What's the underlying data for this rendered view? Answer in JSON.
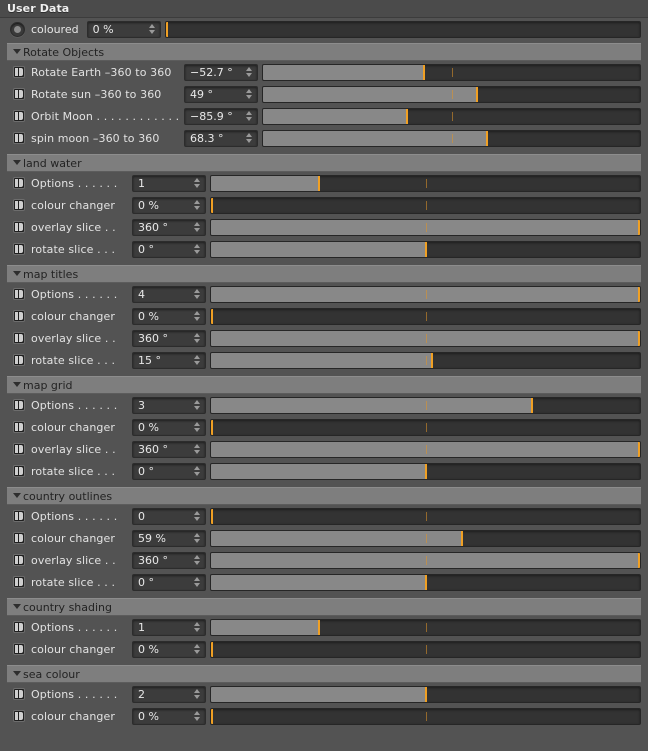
{
  "window": {
    "title": "User Data"
  },
  "top_row": {
    "icon": "radio-button-selected",
    "label": "coloured",
    "value": "0 %",
    "slider": {
      "fill_pct": 0,
      "knob_pct": 0,
      "mid_pct": null
    }
  },
  "sections": [
    {
      "name": "Rotate Objects",
      "label_width": "wide",
      "rows": [
        {
          "icon": "keyframe-track-icon",
          "label": "Rotate Earth –360 to 360",
          "value": "−52.7 °",
          "slider": {
            "fill_pct": 42.6,
            "knob_pct": 42.6,
            "mid_pct": 50
          }
        },
        {
          "icon": "keyframe-track-icon",
          "label": "Rotate sun –360 to 360",
          "value": "49 °",
          "slider": {
            "fill_pct": 56.8,
            "knob_pct": 56.8,
            "mid_pct": 50
          }
        },
        {
          "icon": "keyframe-track-icon",
          "label": "Orbit Moon . . . . . . . . . . . .",
          "value": "−85.9 °",
          "slider": {
            "fill_pct": 38.1,
            "knob_pct": 38.1,
            "mid_pct": 50
          }
        },
        {
          "icon": "keyframe-track-icon",
          "label": "spin moon –360 to 360",
          "value": "68.3 °",
          "slider": {
            "fill_pct": 59.5,
            "knob_pct": 59.5,
            "mid_pct": 50
          }
        }
      ]
    },
    {
      "name": "land water",
      "label_width": "narrow",
      "rows": [
        {
          "icon": "keyframe-track-icon",
          "label": "Options . . . . . .",
          "value": "1",
          "slider": {
            "fill_pct": 25.2,
            "knob_pct": 25.2,
            "mid_pct": 50
          }
        },
        {
          "icon": "keyframe-track-icon",
          "label": "colour changer",
          "value": "0 %",
          "slider": {
            "fill_pct": 0,
            "knob_pct": 0,
            "mid_pct": 50
          }
        },
        {
          "icon": "keyframe-track-icon",
          "label": "overlay slice . .",
          "value": "360 °",
          "slider": {
            "fill_pct": 100,
            "knob_pct": 100,
            "mid_pct": 50
          }
        },
        {
          "icon": "keyframe-track-icon",
          "label": "rotate slice . . .",
          "value": "0 °",
          "slider": {
            "fill_pct": 50,
            "knob_pct": 50,
            "mid_pct": 50
          }
        }
      ]
    },
    {
      "name": "map titles",
      "label_width": "narrow",
      "rows": [
        {
          "icon": "keyframe-track-icon",
          "label": "Options . . . . . .",
          "value": "4",
          "slider": {
            "fill_pct": 100,
            "knob_pct": 100,
            "mid_pct": 50
          }
        },
        {
          "icon": "keyframe-track-icon",
          "label": "colour changer",
          "value": "0 %",
          "slider": {
            "fill_pct": 0,
            "knob_pct": 0,
            "mid_pct": 50
          }
        },
        {
          "icon": "keyframe-track-icon",
          "label": "overlay slice . .",
          "value": "360 °",
          "slider": {
            "fill_pct": 100,
            "knob_pct": 100,
            "mid_pct": 50
          }
        },
        {
          "icon": "keyframe-track-icon",
          "label": "rotate slice . . .",
          "value": "15 °",
          "slider": {
            "fill_pct": 51.5,
            "knob_pct": 51.5,
            "mid_pct": 50
          }
        }
      ]
    },
    {
      "name": "map grid",
      "label_width": "narrow",
      "rows": [
        {
          "icon": "keyframe-track-icon",
          "label": "Options . . . . . .",
          "value": "3",
          "slider": {
            "fill_pct": 74.8,
            "knob_pct": 74.8,
            "mid_pct": 50
          }
        },
        {
          "icon": "keyframe-track-icon",
          "label": "colour changer",
          "value": "0 %",
          "slider": {
            "fill_pct": 0,
            "knob_pct": 0,
            "mid_pct": 50
          }
        },
        {
          "icon": "keyframe-track-icon",
          "label": "overlay slice . .",
          "value": "360 °",
          "slider": {
            "fill_pct": 100,
            "knob_pct": 100,
            "mid_pct": 50
          }
        },
        {
          "icon": "keyframe-track-icon",
          "label": "rotate slice . . .",
          "value": "0 °",
          "slider": {
            "fill_pct": 50,
            "knob_pct": 50,
            "mid_pct": 50
          }
        }
      ]
    },
    {
      "name": "country outlines",
      "label_width": "narrow",
      "rows": [
        {
          "icon": "keyframe-track-icon",
          "label": "Options . . . . . .",
          "value": "0",
          "slider": {
            "fill_pct": 0,
            "knob_pct": 0,
            "mid_pct": 50
          }
        },
        {
          "icon": "keyframe-track-icon",
          "label": "colour changer",
          "value": "59 %",
          "slider": {
            "fill_pct": 58.5,
            "knob_pct": 58.5,
            "mid_pct": 50
          }
        },
        {
          "icon": "keyframe-track-icon",
          "label": "overlay slice . .",
          "value": "360 °",
          "slider": {
            "fill_pct": 100,
            "knob_pct": 100,
            "mid_pct": 50
          }
        },
        {
          "icon": "keyframe-track-icon",
          "label": "rotate slice . . .",
          "value": "0 °",
          "slider": {
            "fill_pct": 50,
            "knob_pct": 50,
            "mid_pct": 50
          }
        }
      ]
    },
    {
      "name": "country shading",
      "label_width": "narrow",
      "rows": [
        {
          "icon": "keyframe-track-icon",
          "label": "Options . . . . . .",
          "value": "1",
          "slider": {
            "fill_pct": 25.2,
            "knob_pct": 25.2,
            "mid_pct": 50
          }
        },
        {
          "icon": "keyframe-track-icon",
          "label": "colour changer",
          "value": "0 %",
          "slider": {
            "fill_pct": 0,
            "knob_pct": 0,
            "mid_pct": 50
          }
        }
      ]
    },
    {
      "name": "sea colour",
      "label_width": "narrow",
      "rows": [
        {
          "icon": "keyframe-track-icon",
          "label": "Options . . . . . .",
          "value": "2",
          "slider": {
            "fill_pct": 50,
            "knob_pct": 50,
            "mid_pct": null
          }
        },
        {
          "icon": "keyframe-track-icon",
          "label": "colour changer",
          "value": "0 %",
          "slider": {
            "fill_pct": 0,
            "knob_pct": 0,
            "mid_pct": 50
          }
        }
      ]
    }
  ],
  "colors": {
    "accent": "#f0a024",
    "panel_bg": "#535353",
    "section_bar": "#7e7e7e",
    "field_bg": "#3c3c3c",
    "slider_track": "#333333",
    "slider_fill": "#888888",
    "text": "#e2e2e2"
  }
}
